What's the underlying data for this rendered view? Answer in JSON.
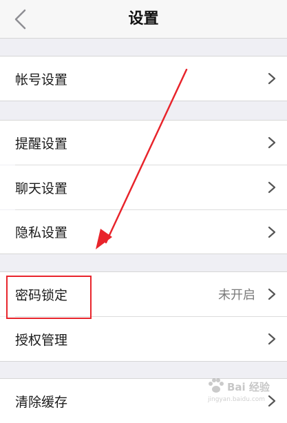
{
  "nav": {
    "title": "设置",
    "back_icon": "chevron-left-icon"
  },
  "groups": [
    {
      "items": [
        {
          "label": "帐号设置"
        }
      ]
    },
    {
      "items": [
        {
          "label": "提醒设置"
        },
        {
          "label": "聊天设置"
        },
        {
          "label": "隐私设置"
        }
      ]
    },
    {
      "items": [
        {
          "label": "密码锁定",
          "value": "未开启"
        },
        {
          "label": "授权管理"
        }
      ]
    },
    {
      "items": [
        {
          "label": "清除缓存"
        }
      ]
    }
  ],
  "annotation": {
    "highlight_color": "#e8242b",
    "arrow_color": "#e8242b"
  },
  "watermark": {
    "text": "Bai 经验",
    "sub": "jingyan.baidu.com"
  }
}
